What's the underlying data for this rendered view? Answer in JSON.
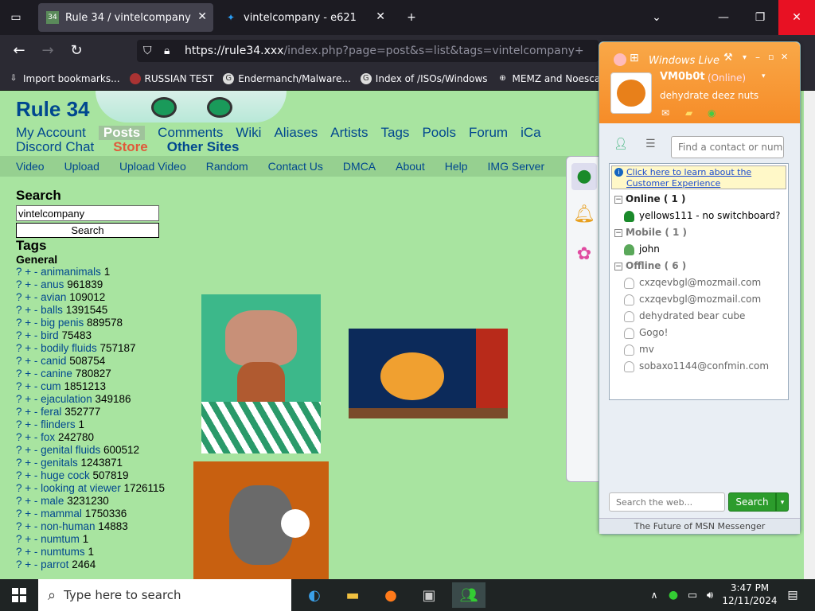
{
  "tabs": [
    {
      "label": "Rule 34 / vintelcompany",
      "active": true
    },
    {
      "label": "vintelcompany - e621",
      "active": false
    }
  ],
  "url": {
    "host": "https://rule34.xxx",
    "path": "/index.php?page=post&s=list&tags=vintelcompany+"
  },
  "bookmarks": [
    "Import bookmarks...",
    "RUSSIAN TEST",
    "Endermanch/Malware...",
    "Index of /ISOs/Windows",
    "MEMZ and Noescape ..."
  ],
  "site": {
    "logo": "Rule 34",
    "nav_row1": [
      "My Account",
      "Posts",
      "Comments",
      "Wiki",
      "Aliases",
      "Artists",
      "Tags",
      "Pools",
      "Forum",
      "iCa"
    ],
    "nav_row2": [
      "Discord Chat",
      "Store",
      "Other Sites"
    ],
    "subnav": [
      "Video",
      "Upload",
      "Upload Video",
      "Random",
      "Contact Us",
      "DMCA",
      "About",
      "Help",
      "IMG Server"
    ]
  },
  "search": {
    "heading": "Search",
    "value": "vintelcompany",
    "button": "Search"
  },
  "tags": {
    "heading": "Tags",
    "subheading": "General",
    "prefix": "? + -",
    "items": [
      {
        "name": "animanimals",
        "count": "1"
      },
      {
        "name": "anus",
        "count": "961839"
      },
      {
        "name": "avian",
        "count": "109012"
      },
      {
        "name": "balls",
        "count": "1391545"
      },
      {
        "name": "big penis",
        "count": "889578"
      },
      {
        "name": "bird",
        "count": "75483"
      },
      {
        "name": "bodily fluids",
        "count": "757187"
      },
      {
        "name": "canid",
        "count": "508754"
      },
      {
        "name": "canine",
        "count": "780827"
      },
      {
        "name": "cum",
        "count": "1851213"
      },
      {
        "name": "ejaculation",
        "count": "349186"
      },
      {
        "name": "feral",
        "count": "352777"
      },
      {
        "name": "flinders",
        "count": "1"
      },
      {
        "name": "fox",
        "count": "242780"
      },
      {
        "name": "genital fluids",
        "count": "600512"
      },
      {
        "name": "genitals",
        "count": "1243871"
      },
      {
        "name": "huge cock",
        "count": "507819"
      },
      {
        "name": "looking at viewer",
        "count": "1726115"
      },
      {
        "name": "male",
        "count": "3231230"
      },
      {
        "name": "mammal",
        "count": "1750336"
      },
      {
        "name": "non-human",
        "count": "14883"
      },
      {
        "name": "numtum",
        "count": "1"
      },
      {
        "name": "numtums",
        "count": "1"
      },
      {
        "name": "parrot",
        "count": "2464"
      }
    ]
  },
  "messenger": {
    "title": "Windows Live",
    "username": "VM0b0t",
    "status": "(Online)",
    "personal_message": "dehydrate deez nuts",
    "find_placeholder": "Find a contact or number",
    "banner": "Click here to learn about the Customer Experience",
    "groups": [
      {
        "label": "Online ( 1 )",
        "contacts": [
          "yellows111 - no switchboard?"
        ]
      },
      {
        "label": "Mobile ( 1 )",
        "contacts": [
          "john"
        ]
      },
      {
        "label": "Offline ( 6 )",
        "contacts": [
          "cxzqevbgl@mozmail.com",
          "cxzqevbgl@mozmail.com",
          "dehydrated bear cube",
          "Gogo!",
          "mv",
          "sobaxo1144@confmin.com"
        ]
      }
    ],
    "web_search_placeholder": "Search the web...",
    "search_button": "Search",
    "footer": "The Future of MSN Messenger"
  },
  "taskbar": {
    "search_placeholder": "Type here to search",
    "time": "3:47 PM",
    "date": "12/11/2024"
  },
  "colors": {
    "page_bg": "#a8e4a0",
    "link": "#00478f",
    "msn_orange": "#f68c28"
  }
}
